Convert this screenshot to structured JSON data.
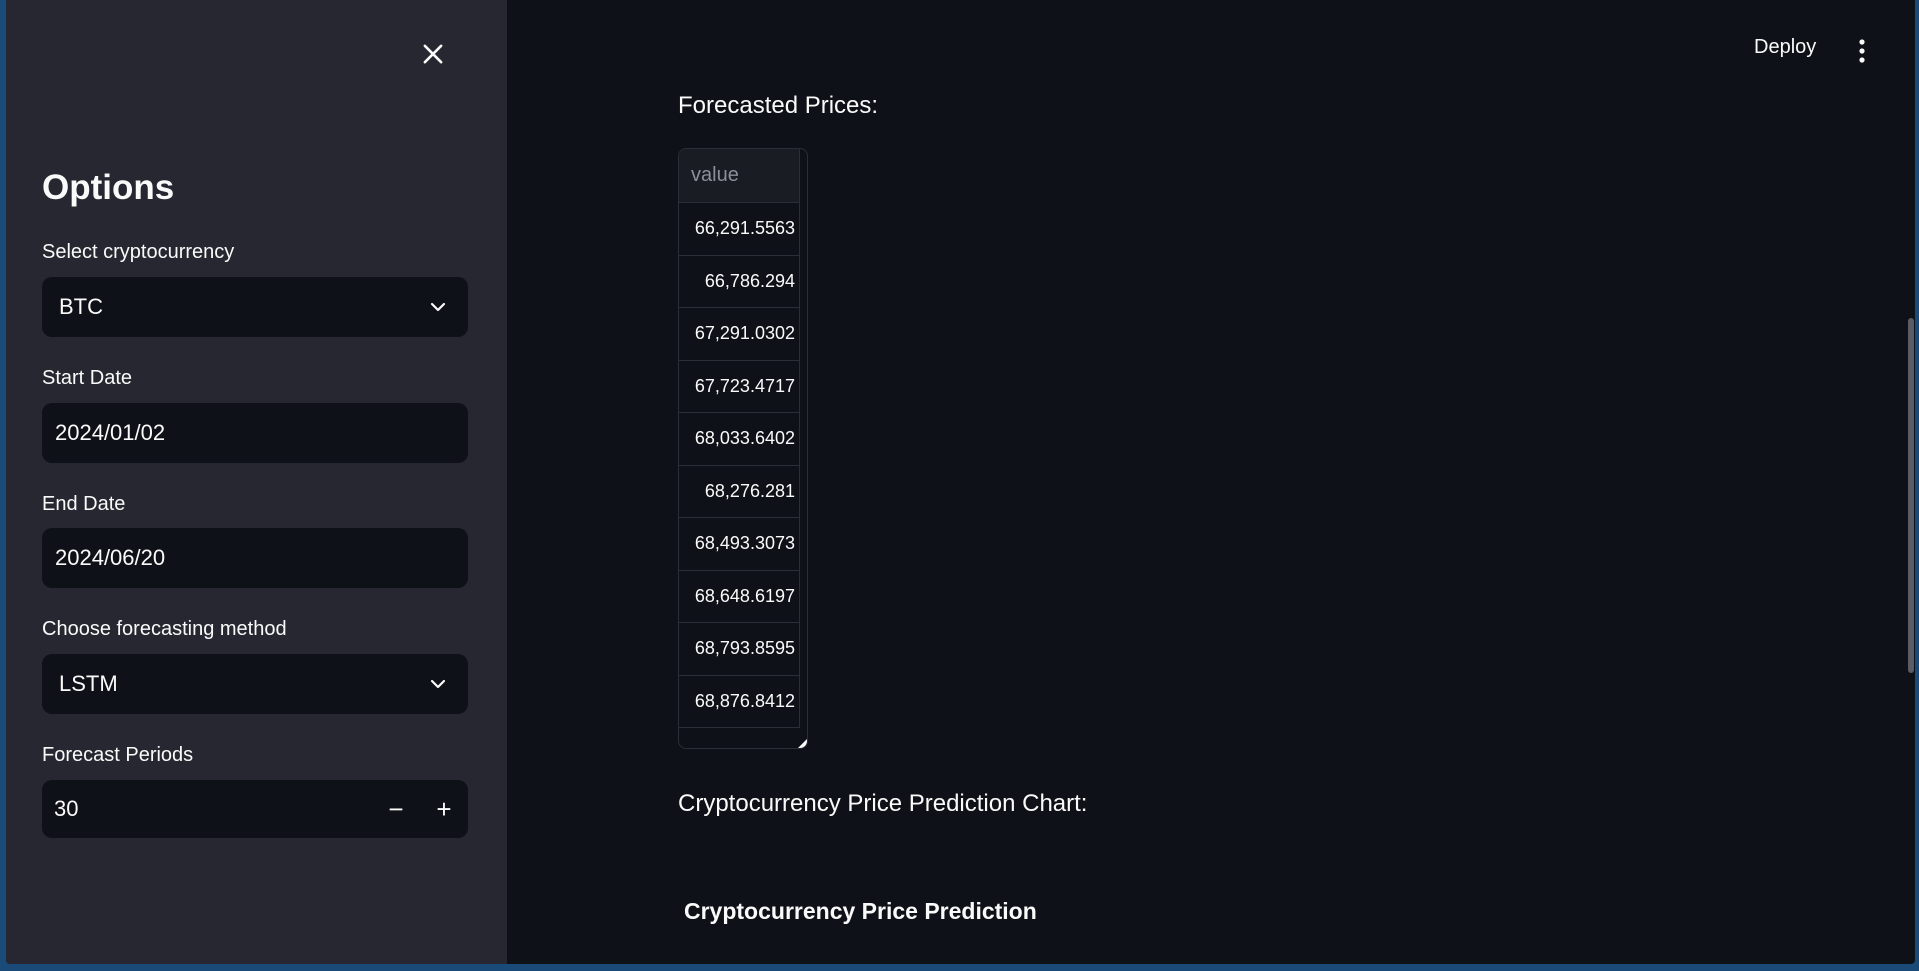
{
  "sidebar": {
    "title": "Options",
    "crypto": {
      "label": "Select cryptocurrency",
      "value": "BTC"
    },
    "start_date": {
      "label": "Start Date",
      "value": "2024/01/02"
    },
    "end_date": {
      "label": "End Date",
      "value": "2024/06/20"
    },
    "method": {
      "label": "Choose forecasting method",
      "value": "LSTM"
    },
    "periods": {
      "label": "Forecast Periods",
      "value": "30",
      "minus": "−",
      "plus": "+"
    }
  },
  "header": {
    "deploy_label": "Deploy"
  },
  "main": {
    "forecast_heading": "Forecasted Prices:",
    "table": {
      "column": "value",
      "rows": [
        "66,291.5563",
        "66,786.294",
        "67,291.0302",
        "67,723.4717",
        "68,033.6402",
        "68,276.281",
        "68,493.3073",
        "68,648.6197",
        "68,793.8595",
        "68,876.8412"
      ]
    },
    "chart_heading": "Cryptocurrency Price Prediction Chart:",
    "chart_title": "Cryptocurrency Price Prediction"
  },
  "colors": {
    "background": "#0e1117",
    "sidebar": "#262730",
    "input": "#0e1117",
    "text": "#fafafa"
  }
}
